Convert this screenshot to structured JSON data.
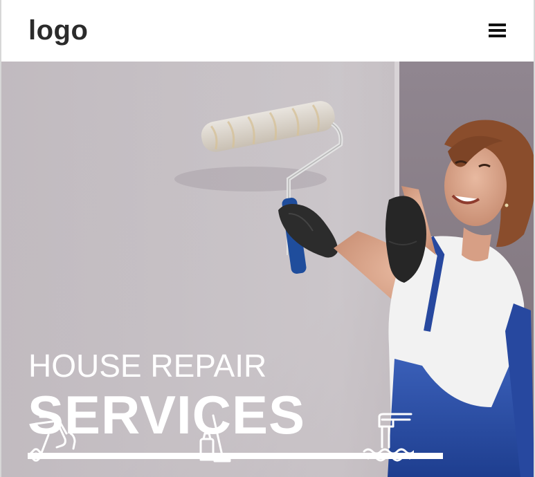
{
  "header": {
    "logo_text": "logo",
    "menu_icon": "hamburger-menu-icon"
  },
  "hero": {
    "title_line1": "HOUSE REPAIR",
    "title_line2": "SERVICES",
    "photo_description_icon": "painter-woman-photo"
  },
  "services": [
    {
      "icon": "paint-roller-icon"
    },
    {
      "icon": "cleaning-supplies-icon"
    },
    {
      "icon": "plumbing-faucet-icon"
    }
  ],
  "colors": {
    "header_bg": "#ffffff",
    "logo_text": "#2b2b2b",
    "hero_text": "#ffffff",
    "hero_bg": "#a99da3"
  }
}
